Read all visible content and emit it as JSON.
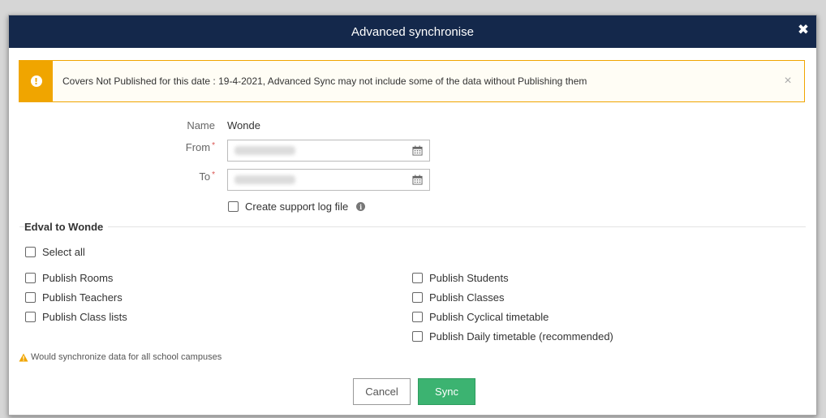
{
  "dialog": {
    "title": "Advanced synchronise",
    "close_glyph": "✖"
  },
  "alert": {
    "icon_glyph": "!",
    "message": "Covers Not Published for this date : 19-4-2021, Advanced Sync may not include some of the data without Publishing them",
    "close_glyph": "×"
  },
  "form": {
    "name_label": "Name",
    "name_value": "Wonde",
    "from_label": "From",
    "to_label": "To",
    "required_mark": "*",
    "support_log_label": "Create support log file",
    "info_glyph": "i"
  },
  "section": {
    "title": "Edval to Wonde",
    "select_all_label": "Select all",
    "left_options": [
      "Publish Rooms",
      "Publish Teachers",
      "Publish Class lists"
    ],
    "right_options": [
      "Publish Students",
      "Publish Classes",
      "Publish Cyclical timetable",
      "Publish Daily timetable (recommended)"
    ]
  },
  "warning": {
    "text": "Would synchronize data for all school campuses"
  },
  "buttons": {
    "cancel_label": "Cancel",
    "sync_label": "Sync"
  },
  "colors": {
    "header_bg": "#14284b",
    "alert_accent": "#f0a500",
    "sync_green": "#3cb371"
  }
}
